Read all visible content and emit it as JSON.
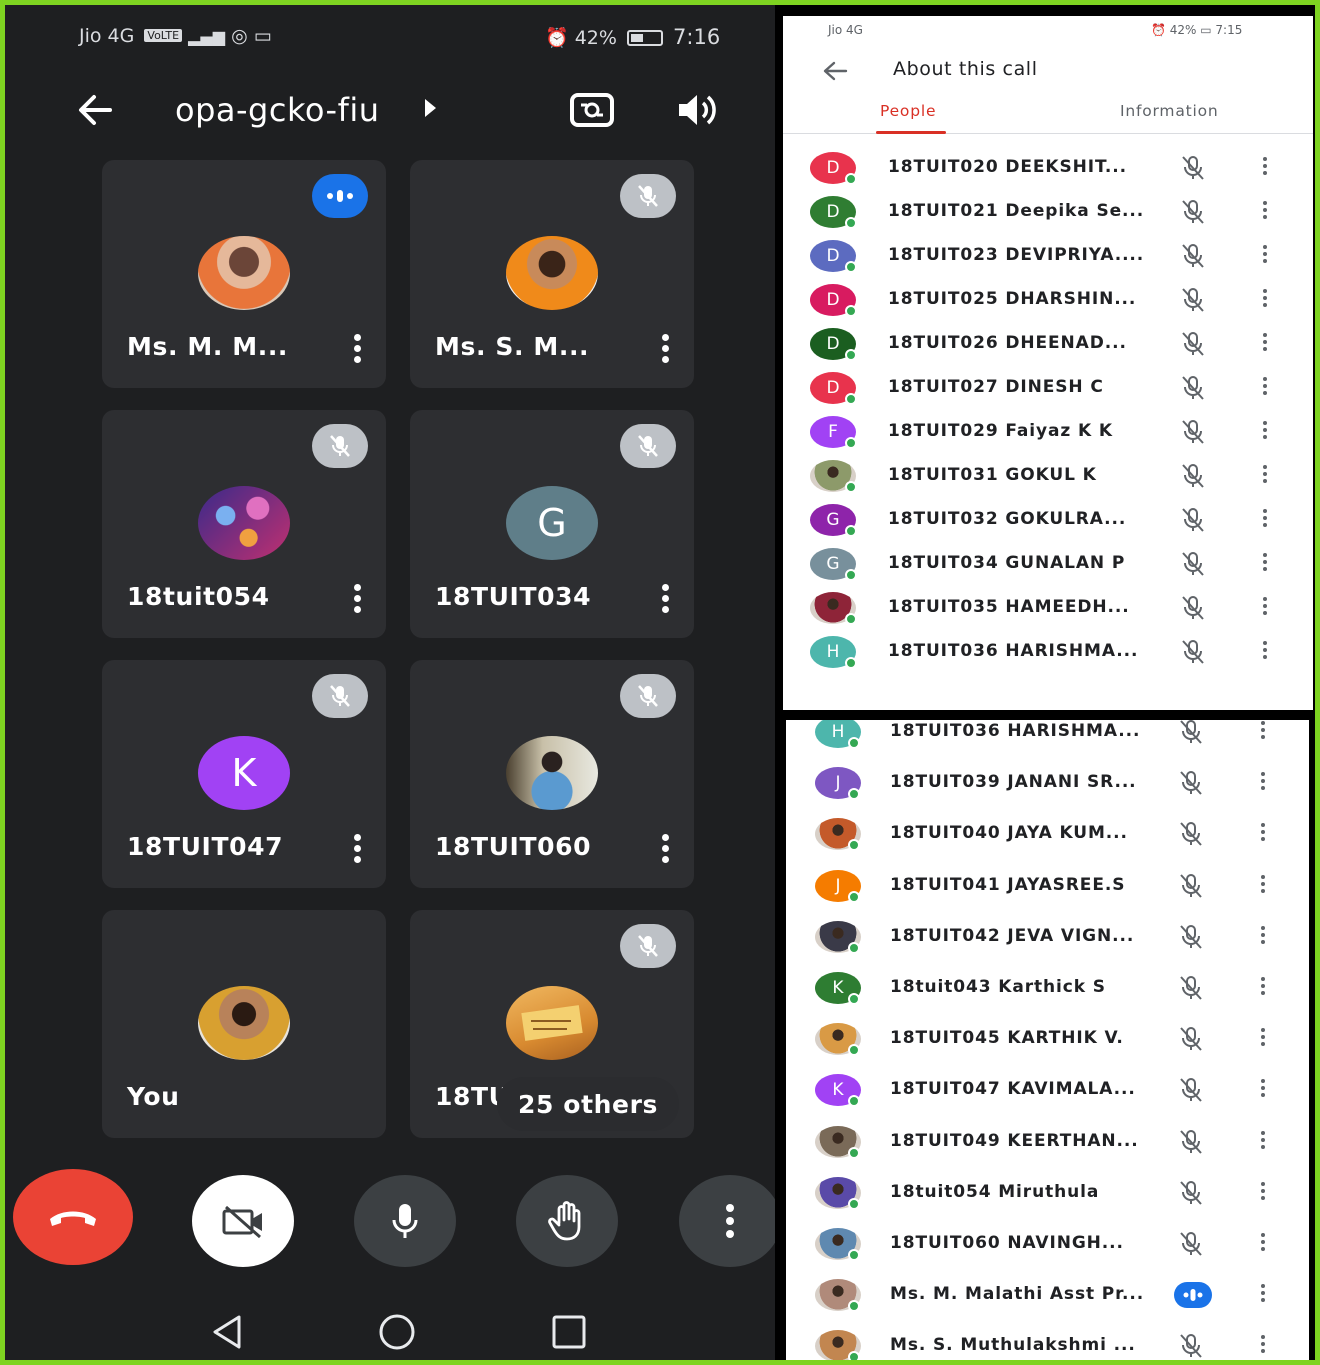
{
  "call": {
    "status": {
      "carrier": "Jio 4G",
      "volte": "VoLTE",
      "net": "4G",
      "battery": "42%",
      "time": "7:16"
    },
    "meeting_code": "opa-gcko-fiu",
    "tiles": [
      {
        "name": "Ms. M. M...",
        "avatar": "photo",
        "state": "speaking"
      },
      {
        "name": "Ms. S. M...",
        "avatar": "photo",
        "state": "muted"
      },
      {
        "name": "18tuit054",
        "avatar": "photo",
        "state": "muted"
      },
      {
        "name": "18TUIT034",
        "avatar": "G",
        "color": "#5f7e89",
        "state": "muted"
      },
      {
        "name": "18TUIT047",
        "avatar": "K",
        "color": "#a142f4",
        "state": "muted"
      },
      {
        "name": "18TUIT060",
        "avatar": "photo",
        "state": "muted"
      },
      {
        "name": "You",
        "avatar": "photo",
        "state": "none"
      },
      {
        "name": "18TUIT045",
        "avatar": "photo",
        "state": "muted"
      }
    ],
    "others_label": "25 others",
    "end_call_color": "#ea4335"
  },
  "panel": {
    "status": {
      "carrier": "Jio 4G",
      "battery": "42%",
      "time": "7:15"
    },
    "title": "About this call",
    "tabs": {
      "people": "People",
      "information": "Information"
    },
    "accent": "#d93025"
  },
  "people_top": [
    {
      "name": "18TUIT020 DEEKSHIT...",
      "initial": "D",
      "color": "#e8334d"
    },
    {
      "name": "18TUIT021 Deepika Se...",
      "initial": "D",
      "color": "#2f7d32"
    },
    {
      "name": "18TUIT023 DEVIPRIYA....",
      "initial": "D",
      "color": "#5c6bc0"
    },
    {
      "name": "18TUIT025 DHARSHIN...",
      "initial": "D",
      "color": "#d81b60"
    },
    {
      "name": "18TUIT026 DHEENAD...",
      "initial": "D",
      "color": "#1b5e20"
    },
    {
      "name": "18TUIT027 DINESH C",
      "initial": "D",
      "color": "#e8334d"
    },
    {
      "name": "18TUIT029 Faiyaz K K",
      "initial": "F",
      "color": "#a142f4"
    },
    {
      "name": "18TUIT031 GOKUL K",
      "initial": "",
      "color": "#8d9a6a"
    },
    {
      "name": "18TUIT032 GOKULRA...",
      "initial": "G",
      "color": "#8e24aa"
    },
    {
      "name": "18TUIT034 GUNALAN P",
      "initial": "G",
      "color": "#78909c"
    },
    {
      "name": "18TUIT035 HAMEEDH...",
      "initial": "",
      "color": "#8e2438"
    },
    {
      "name": "18TUIT036 HARISHMA...",
      "initial": "H",
      "color": "#4db6ac"
    }
  ],
  "people_bottom": [
    {
      "name": "18TUIT036 HARISHMA...",
      "initial": "H",
      "color": "#4db6ac"
    },
    {
      "name": "18TUIT039 JANANI SR...",
      "initial": "J",
      "color": "#7e57c2"
    },
    {
      "name": "18TUIT040 JAYA KUM...",
      "initial": "",
      "color": "#c45a2a"
    },
    {
      "name": "18TUIT041 JAYASREE.S",
      "initial": "J",
      "color": "#f57c00"
    },
    {
      "name": "18TUIT042 JEVA VIGN...",
      "initial": "",
      "color": "#3a3a48"
    },
    {
      "name": "18tuit043 Karthick S",
      "initial": "K",
      "color": "#2e7d32"
    },
    {
      "name": "18TUIT045 KARTHIK V.",
      "initial": "",
      "color": "#d99a45"
    },
    {
      "name": "18TUIT047 KAVIMALA...",
      "initial": "K",
      "color": "#a142f4"
    },
    {
      "name": "18TUIT049 KEERTHAN...",
      "initial": "",
      "color": "#7a6a58"
    },
    {
      "name": "18tuit054 Miruthula",
      "initial": "",
      "color": "#5a4aa8"
    },
    {
      "name": "18TUIT060 NAVINGH...",
      "initial": "",
      "color": "#5f89b0"
    },
    {
      "name": "Ms. M. Malathi Asst Pr...",
      "initial": "",
      "color": "#b08a7a",
      "speaking": true
    },
    {
      "name": "Ms. S. Muthulakshmi ...",
      "initial": "",
      "color": "#c28650"
    }
  ]
}
